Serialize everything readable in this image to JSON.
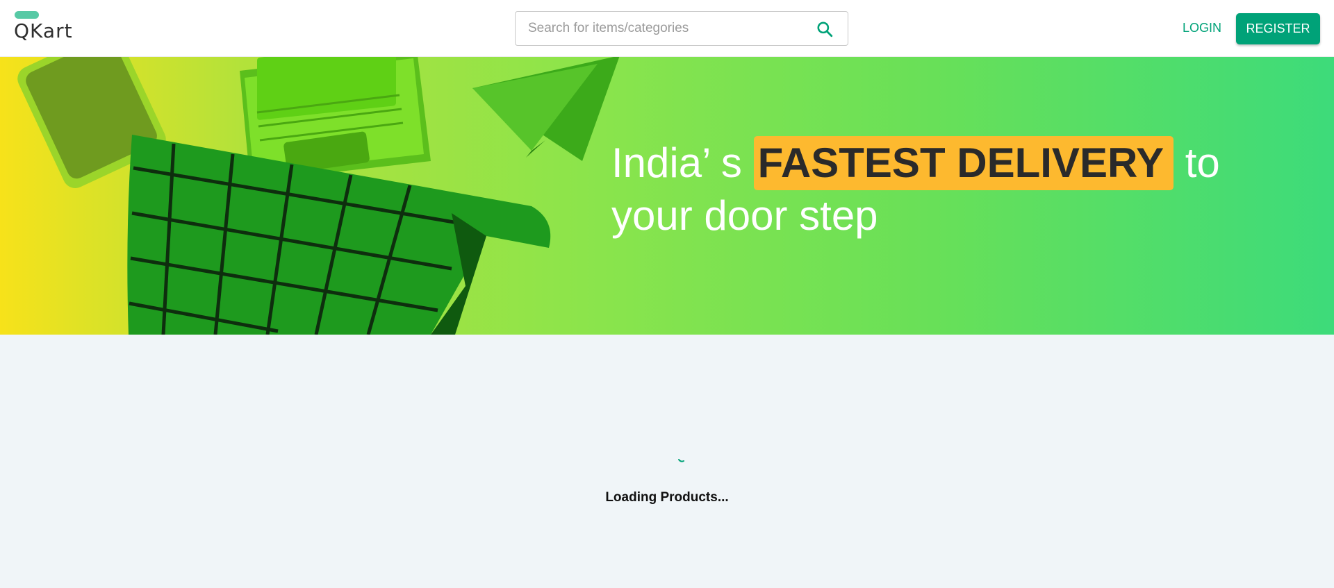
{
  "header": {
    "logo_text": "QKart",
    "search": {
      "placeholder": "Search for items/categories",
      "value": "",
      "icon": "search-icon"
    },
    "login_label": "LOGIN",
    "register_label": "REGISTER"
  },
  "hero": {
    "text_before": "India’ s ",
    "highlight": "FASTEST DELIVERY",
    "text_after": " to your door step"
  },
  "loading": {
    "text": "Loading Products..."
  },
  "colors": {
    "brand": "#00a278",
    "logo_accent": "#57c9a5",
    "highlight": "#fdb92f",
    "background": "#f0f5f8"
  }
}
